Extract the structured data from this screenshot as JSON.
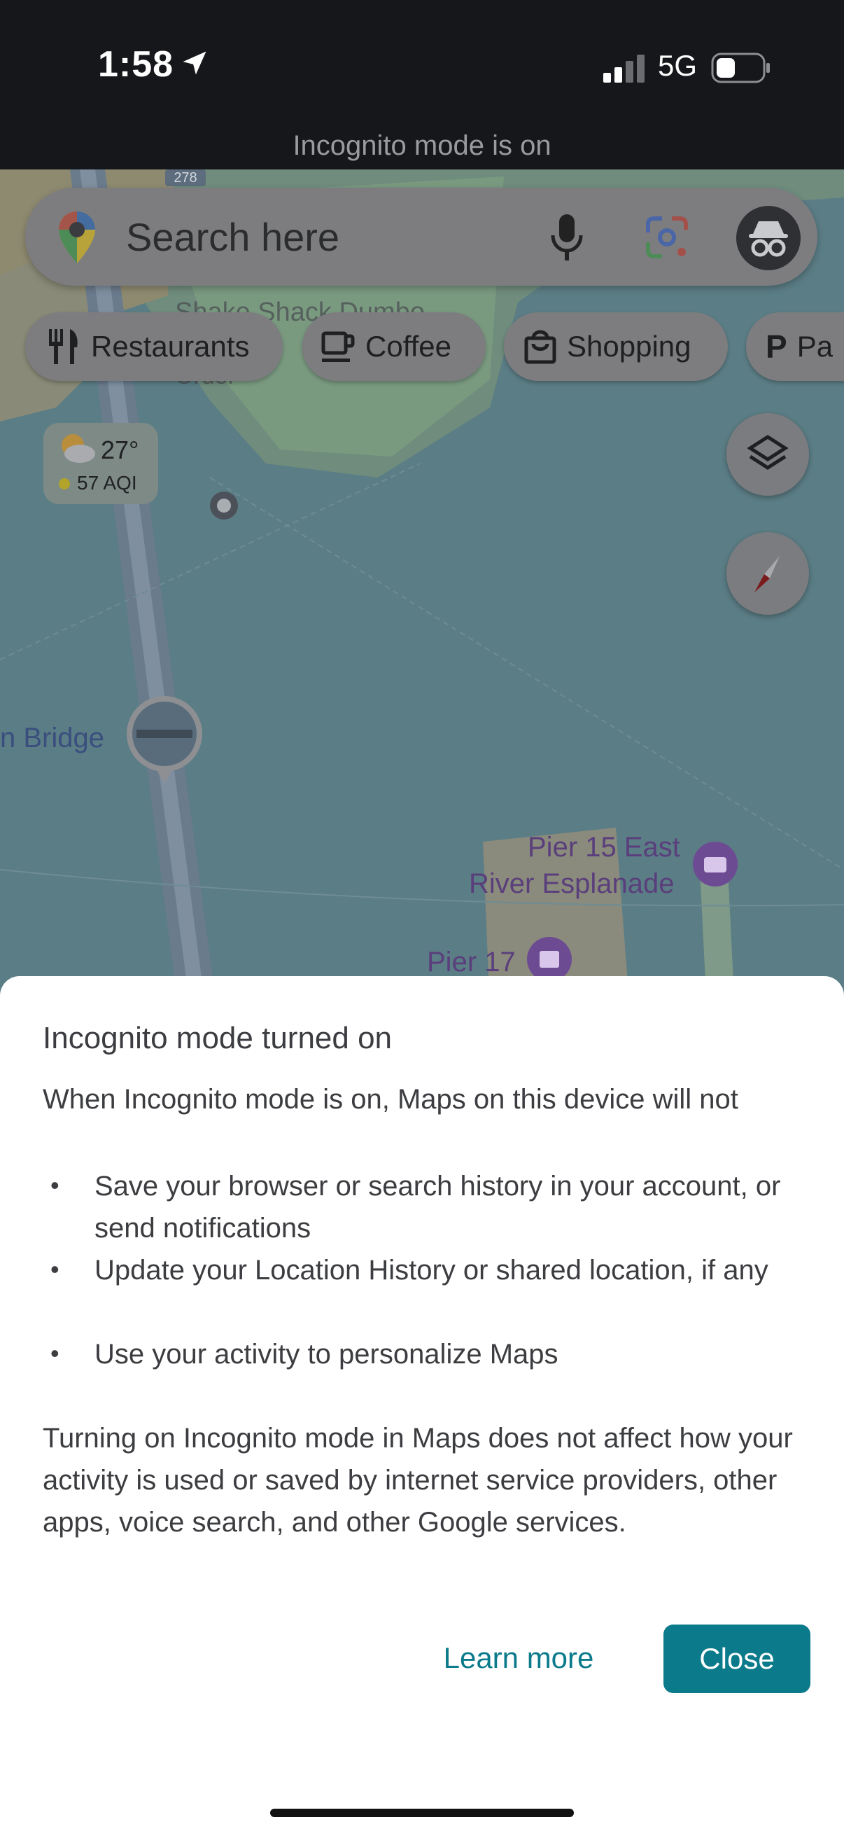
{
  "status_bar": {
    "time": "1:58",
    "network": "5G",
    "location_icon": "location-arrow-icon",
    "signal_icon": "cellular-signal-icon",
    "battery_icon": "battery-icon"
  },
  "incognito_banner": "Incognito mode is on",
  "search": {
    "placeholder": "Search here",
    "icons": [
      "google-maps-pin-icon",
      "microphone-icon",
      "google-lens-icon",
      "incognito-avatar-icon"
    ]
  },
  "chips": [
    {
      "label": "Restaurants",
      "icon": "restaurant-icon"
    },
    {
      "label": "Coffee",
      "icon": "coffee-icon"
    },
    {
      "label": "Shopping",
      "icon": "shopping-bag-icon"
    },
    {
      "label": "Pa",
      "icon": "parking-icon"
    }
  ],
  "weather": {
    "temperature": "27°",
    "aqi": "57 AQI",
    "icon": "partly-cloudy-icon"
  },
  "map_labels": {
    "bridge": "n Bridge",
    "pier15_line1": "Pier 15 East",
    "pier15_line2": "River Esplanade",
    "pier17": "Pier 17",
    "route_number": "278",
    "place_partial_1": "Shake Shack Dumbo",
    "place_partial_2": "Order"
  },
  "map_buttons": {
    "layers": "layers-icon",
    "compass": "compass-icon"
  },
  "sheet": {
    "title": "Incognito mode turned on",
    "intro": "When Incognito mode is on, Maps on this device will not",
    "bullets": [
      "Save your browser or search history in your account, or send notifications",
      "Update your Location History or shared location, if any",
      "Use your activity to personalize Maps"
    ],
    "footer": "Turning on Incognito mode in Maps does not affect how your activity is used or saved by internet service providers, other apps, voice search, and other Google services.",
    "learn_more": "Learn more",
    "close": "Close"
  },
  "colors": {
    "accent": "#0b7a8a",
    "status_bar": "#16171a",
    "water": "#5b7d85"
  }
}
